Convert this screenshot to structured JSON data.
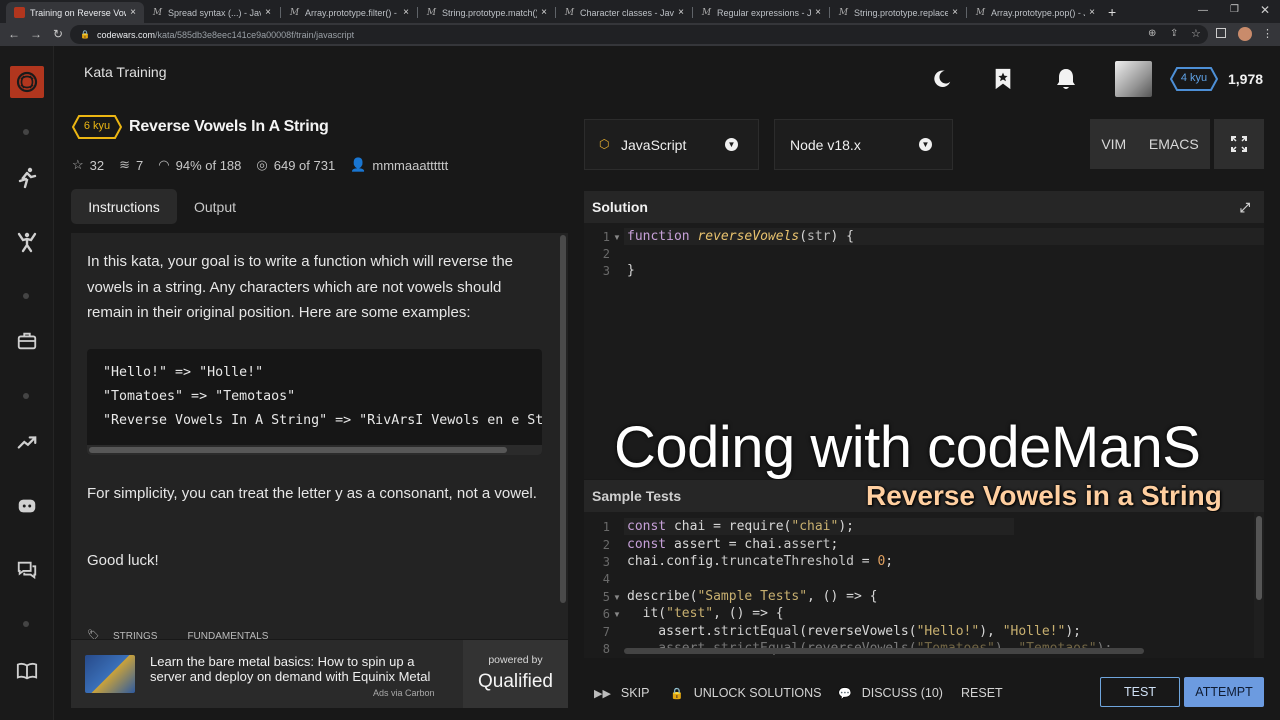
{
  "browser": {
    "tabs": [
      {
        "title": "Training on Reverse Vowels",
        "active": true
      },
      {
        "title": "Spread syntax (...) - JavaScri"
      },
      {
        "title": "Array.prototype.filter() - Ja"
      },
      {
        "title": "String.prototype.match() -"
      },
      {
        "title": "Character classes - JavaScri"
      },
      {
        "title": "Regular expressions - Java"
      },
      {
        "title": "String.prototype.replace()"
      },
      {
        "title": "Array.prototype.pop() - Ja"
      }
    ],
    "new_tab": "+",
    "url_host": "codewars.com",
    "url_path": "/kata/585db3e8eec141ce9a00008f/train/javascript"
  },
  "header": {
    "section_title": "Kata Training",
    "rank": "4 kyu",
    "honor": "1,978"
  },
  "kata": {
    "kyu": "6 kyu",
    "title": "Reverse Vowels In A String",
    "stats": {
      "stars": "32",
      "collections": "7",
      "satisfaction": "94% of 188",
      "completed": "649 of 731",
      "author": "mmmaaatttttt"
    },
    "tabs": {
      "instructions": "Instructions",
      "output": "Output"
    },
    "description_intro": "In this kata, your goal is to write a function which will reverse the vowels in a string. Any characters which are not vowels should remain in their original position. Here are some examples:",
    "examples": [
      "\"Hello!\" => \"Holle!\"",
      "\"Tomatoes\" => \"Temotaos\"",
      "\"Reverse Vowels In A String\" => \"RivArsI Vewols en e Stre"
    ],
    "description_note": "For simplicity, you can treat the letter y as a consonant, not a vowel.",
    "description_outro": "Good luck!",
    "tags": [
      "STRINGS",
      "FUNDAMENTALS"
    ]
  },
  "ad": {
    "text": "Learn the bare metal basics: How to spin up a server and deploy on demand with Equinix Metal",
    "via": "Ads via Carbon",
    "powered_by": "powered by",
    "brand": "Qualified"
  },
  "editor": {
    "language": "JavaScript",
    "runtime": "Node v18.x",
    "mode_vim": "VIM",
    "mode_emacs": "EMACS",
    "solution_label": "Solution",
    "solution_lines": [
      "1",
      "2",
      "3"
    ],
    "tests_label": "Sample Tests",
    "test_line_numbers": [
      "1",
      "2",
      "3",
      "4",
      "5",
      "6",
      "7",
      "8"
    ]
  },
  "overlay": {
    "line1": "Coding with codeManS",
    "line2": "Reverse Vowels in a String"
  },
  "actions": {
    "skip": "SKIP",
    "unlock": "UNLOCK SOLUTIONS",
    "discuss": "DISCUSS (10)",
    "reset": "RESET",
    "test": "TEST",
    "attempt": "ATTEMPT"
  }
}
